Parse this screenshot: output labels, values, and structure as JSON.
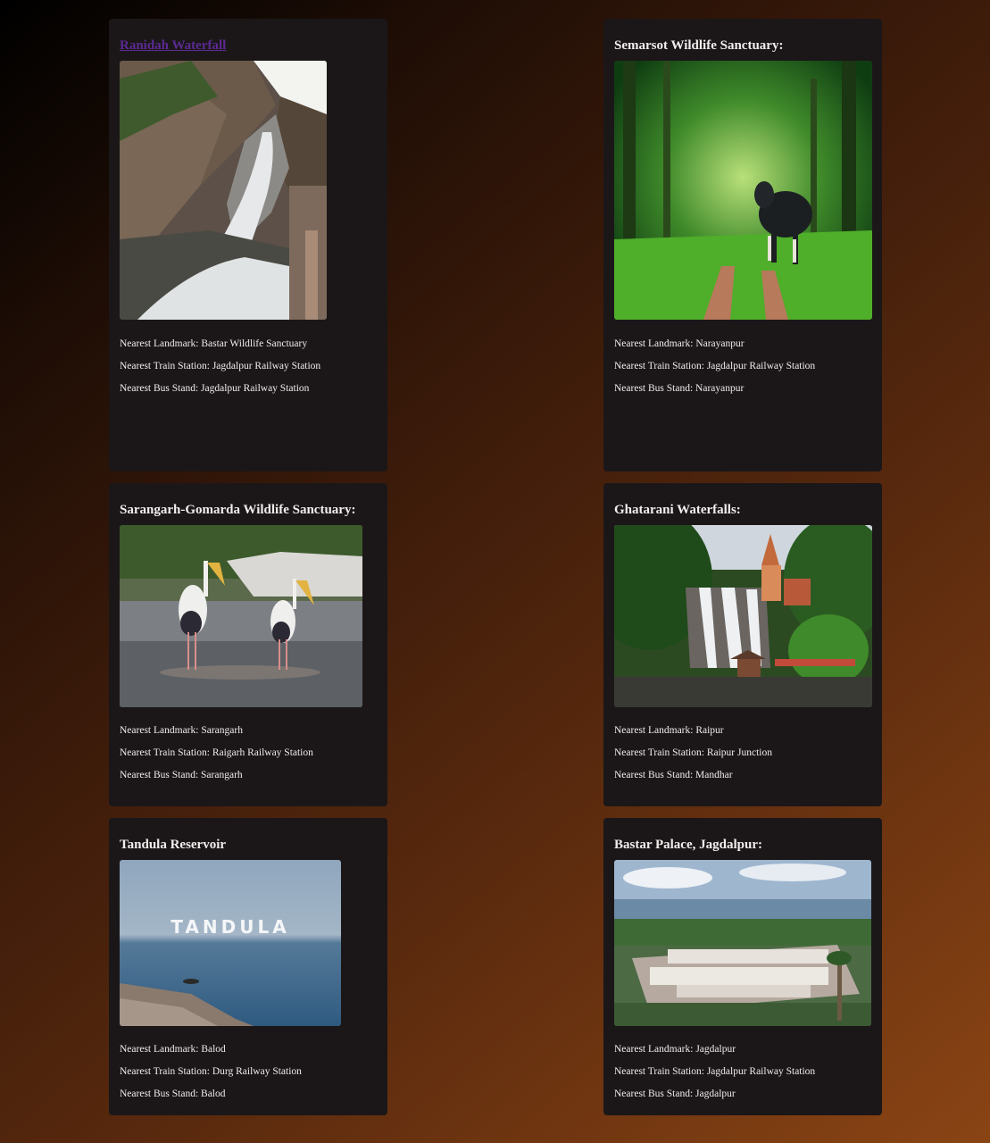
{
  "places": [
    {
      "title": "Ranidah Waterfall",
      "landmark": "Nearest Landmark: Bastar Wildlife Sanctuary",
      "train": "Nearest Train Station: Jagdalpur Railway Station",
      "bus": "Nearest Bus Stand: Jagdalpur Railway Station"
    },
    {
      "title": "Semarsot Wildlife Sanctuary:",
      "landmark": "Nearest Landmark: Narayanpur",
      "train": "Nearest Train Station: Jagdalpur Railway Station",
      "bus": "Nearest Bus Stand: Narayanpur"
    },
    {
      "title": "Sarangarh-Gomarda Wildlife Sanctuary:",
      "landmark": "Nearest Landmark: Sarangarh",
      "train": "Nearest Train Station: Raigarh Railway Station",
      "bus": "Nearest Bus Stand: Sarangarh"
    },
    {
      "title": "Ghatarani Waterfalls:",
      "landmark": "Nearest Landmark: Raipur",
      "train": "Nearest Train Station: Raipur Junction",
      "bus": "Nearest Bus Stand: Mandhar"
    },
    {
      "title": "Tandula Reservoir",
      "image_text": "TANDULA",
      "landmark": "Nearest Landmark: Balod",
      "train": "Nearest Train Station: Durg Railway Station",
      "bus": "Nearest Bus Stand: Balod"
    },
    {
      "title": "Bastar Palace, Jagdalpur:",
      "landmark": "Nearest Landmark: Jagdalpur",
      "train": "Nearest Train Station: Jagdalpur Railway Station",
      "bus": "Nearest Bus Stand: Jagdalpur"
    }
  ],
  "colors": {
    "card_background": "#1b1718",
    "link_title": "#5b2a93",
    "text": "#f0ecec"
  }
}
